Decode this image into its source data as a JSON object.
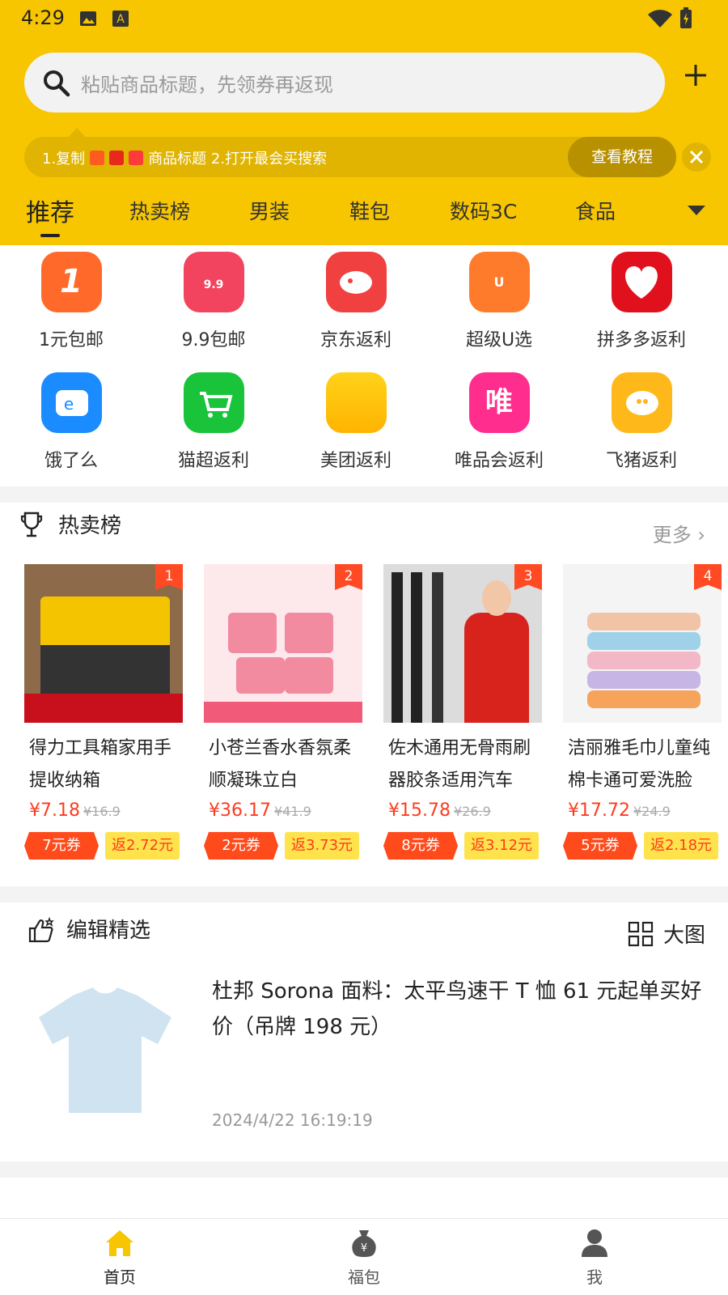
{
  "status_bar": {
    "time": "4:29"
  },
  "search": {
    "placeholder": "粘贴商品标题，先领券再返现"
  },
  "tip": {
    "text_prefix": "1.复制",
    "text_suffix": "商品标题  2.打开最会买搜索",
    "tutorial_label": "查看教程"
  },
  "tabs": [
    "推荐",
    "热卖榜",
    "男装",
    "鞋包",
    "数码3C",
    "食品"
  ],
  "shortcuts": [
    {
      "label": "1元包邮",
      "icon": "one-yuan-icon",
      "color": "#ff6a2a"
    },
    {
      "label": "9.9包邮",
      "icon": "shopping-bag-icon",
      "color": "#f2445e"
    },
    {
      "label": "京东返利",
      "icon": "jd-dog-icon",
      "color": "#f04040"
    },
    {
      "label": "超级U选",
      "icon": "super-u-icon",
      "color": "#ff7b2c"
    },
    {
      "label": "拼多多返利",
      "icon": "pinduoduo-icon",
      "color": "#e0101c"
    },
    {
      "label": "饿了么",
      "icon": "eleme-icon",
      "color": "#1a8cff"
    },
    {
      "label": "猫超返利",
      "icon": "cart-icon",
      "color": "#19c43b"
    },
    {
      "label": "美团返利",
      "icon": "meituan-icon",
      "color": "#ffc81a"
    },
    {
      "label": "唯品会返利",
      "icon": "vip-icon",
      "color": "#ff2e8e"
    },
    {
      "label": "飞猪返利",
      "icon": "fliggy-icon",
      "color": "#ffb81a"
    }
  ],
  "hot": {
    "title": "热卖榜",
    "more_label": "更多",
    "items": [
      {
        "rank": "1",
        "name": "得力工具箱家用手提收纳箱",
        "price": "¥7.18",
        "orig": "¥16.9",
        "coupon": "7元券",
        "rebate": "返2.72元"
      },
      {
        "rank": "2",
        "name": "小苍兰香水香氛柔顺凝珠立白",
        "price": "¥36.17",
        "orig": "¥41.9",
        "coupon": "2元券",
        "rebate": "返3.73元"
      },
      {
        "rank": "3",
        "name": "佐木通用无骨雨刷器胶条适用汽车",
        "price": "¥15.78",
        "orig": "¥26.9",
        "coupon": "8元券",
        "rebate": "返3.12元"
      },
      {
        "rank": "4",
        "name": "洁丽雅毛巾儿童纯棉卡通可爱洗脸",
        "price": "¥17.72",
        "orig": "¥24.9",
        "coupon": "5元券",
        "rebate": "返2.18元"
      }
    ]
  },
  "picks": {
    "title": "编辑精选",
    "view_label": "大图",
    "items": [
      {
        "title": "杜邦 Sorona 面料：太平鸟速干 T 恤 61 元起单买好价（吊牌 198 元）",
        "time": "2024/4/22 16:19:19"
      }
    ]
  },
  "bottom_nav": [
    "首页",
    "福包",
    "我"
  ],
  "colors": {
    "brand_yellow": "#f7c600",
    "price_red": "#ff3b1f",
    "coupon_orange": "#ff4a1c",
    "rebate_yellow": "#ffe34d"
  }
}
